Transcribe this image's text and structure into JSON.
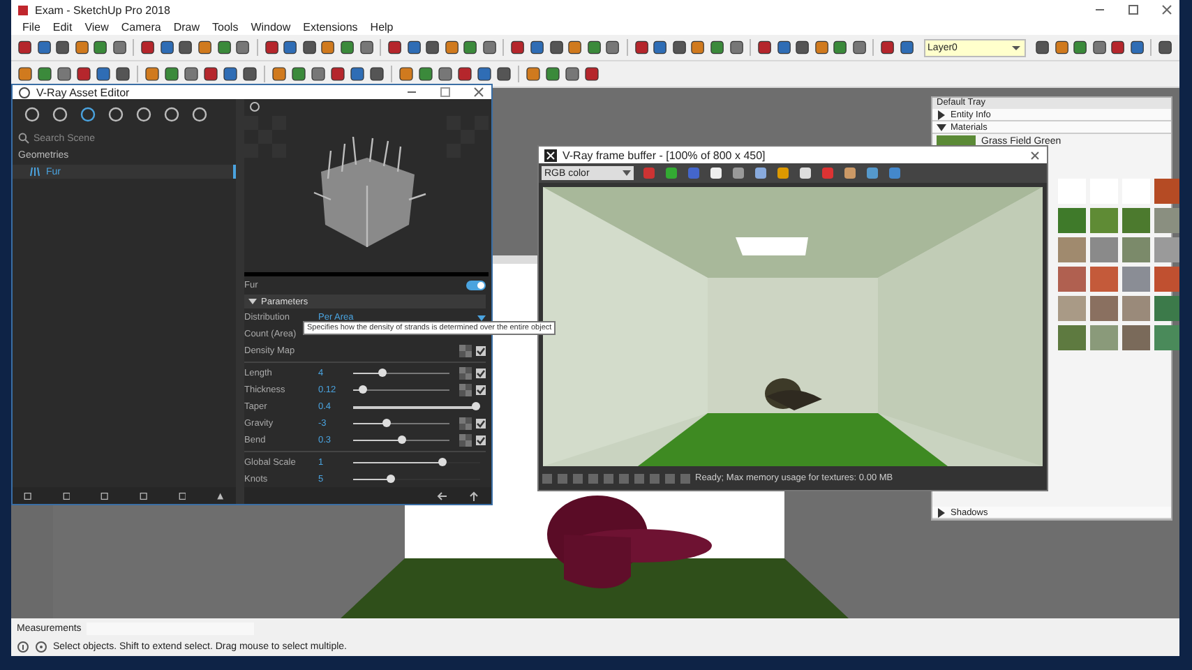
{
  "window": {
    "title": "Exam - SketchUp Pro 2018"
  },
  "menu": [
    {
      "label": "File"
    },
    {
      "label": "Edit"
    },
    {
      "label": "View"
    },
    {
      "label": "Camera"
    },
    {
      "label": "Draw"
    },
    {
      "label": "Tools"
    },
    {
      "label": "Window"
    },
    {
      "label": "Extensions"
    },
    {
      "label": "Help"
    }
  ],
  "layer_field": {
    "value": "Layer0"
  },
  "asset_editor": {
    "title": "V-Ray Asset Editor",
    "search": {
      "placeholder": "Search Scene"
    },
    "category": "Geometries",
    "items": [
      {
        "label": "Fur",
        "selected": true
      }
    ],
    "fur_toggle": {
      "label": "Fur",
      "on": true
    },
    "section": {
      "label": "Parameters",
      "expanded": true
    },
    "rows": [
      {
        "kind": "dropdown",
        "label": "Distribution",
        "value": "Per Area"
      },
      {
        "kind": "text",
        "label": "Count (Area)"
      },
      {
        "kind": "map",
        "label": "Density Map",
        "checked": true
      },
      {
        "kind": "rule"
      },
      {
        "kind": "slider",
        "label": "Length",
        "value": "4",
        "level": 0.3,
        "checked": true
      },
      {
        "kind": "slider",
        "label": "Thickness",
        "value": "0.12",
        "level": 0.1,
        "checked": true
      },
      {
        "kind": "wide",
        "label": "Taper",
        "value": "0.4",
        "level": 0.97
      },
      {
        "kind": "slider",
        "label": "Gravity",
        "value": "-3",
        "level": 0.35,
        "checked": true
      },
      {
        "kind": "slider",
        "label": "Bend",
        "value": "0.3",
        "level": 0.5,
        "checked": true
      },
      {
        "kind": "rule"
      },
      {
        "kind": "plain",
        "label": "Global Scale",
        "value": "1",
        "level": 0.7
      },
      {
        "kind": "plain",
        "label": "Knots",
        "value": "5",
        "level": 0.3
      }
    ]
  },
  "tooltip": "Specifies how the density of strands is determined over the entire object",
  "frame_buffer": {
    "title": "V-Ray frame buffer - [100% of 800 x 450]",
    "channel": "RGB color",
    "status": "Ready; Max memory usage for textures: 0.00 MB"
  },
  "tray": {
    "title": "Default Tray",
    "panels": [
      {
        "label": "Entity Info",
        "expanded": false
      },
      {
        "label": "Materials",
        "expanded": true
      }
    ],
    "material_name": "Grass Field Green",
    "lower_panels": [
      {
        "label": "Shadows",
        "expanded": false
      }
    ]
  },
  "status_bar": {
    "measurements_label": "Measurements",
    "hint": "Select objects. Shift to extend select. Drag mouse to select multiple."
  }
}
